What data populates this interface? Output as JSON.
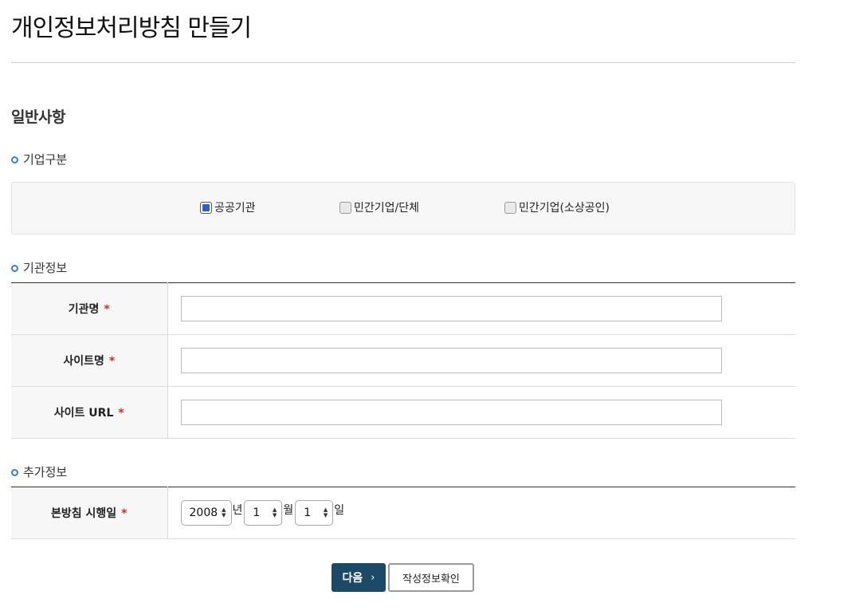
{
  "page_title": "개인정보처리방침 만들기",
  "section_title": "일반사항",
  "company_type": {
    "heading": "기업구분",
    "options": [
      {
        "label": "공공기관",
        "checked": true
      },
      {
        "label": "민간기업/단체",
        "checked": false
      },
      {
        "label": "민간기업(소상공인)",
        "checked": false
      }
    ]
  },
  "org_info": {
    "heading": "기관정보",
    "fields": [
      {
        "label": "기관명",
        "value": ""
      },
      {
        "label": "사이트명",
        "value": ""
      },
      {
        "label": "사이트 URL",
        "value": ""
      }
    ],
    "required_mark": "*"
  },
  "extra_info": {
    "heading": "추가정보",
    "effective_date": {
      "label": "본방침 시행일",
      "year": "2008",
      "year_unit": "년",
      "month": "1",
      "month_unit": "월",
      "day": "1",
      "day_unit": "일"
    }
  },
  "buttons": {
    "next": "다음",
    "next_chevron": "›",
    "confirm": "작성정보확인"
  },
  "colors": {
    "primary_button": "#1c4a66",
    "required": "#e0262b",
    "bullet": "#3d7fb8",
    "checked": "#2f5fc0"
  }
}
